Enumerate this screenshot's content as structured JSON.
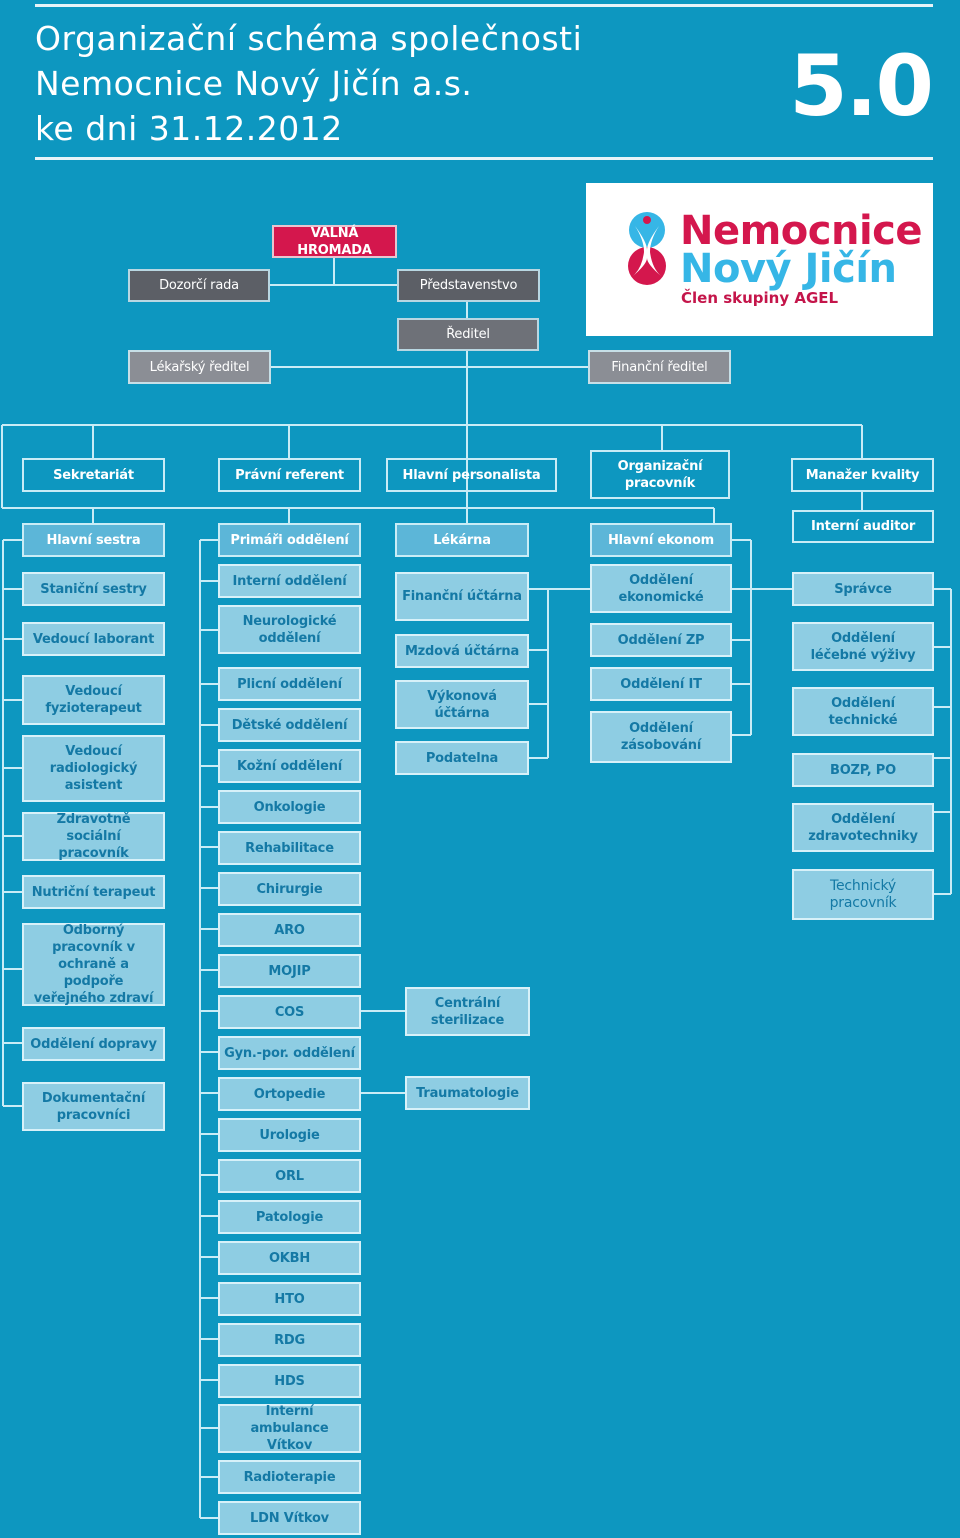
{
  "header": {
    "title_lines": [
      "Organizační schéma společnosti",
      "Nemocnice Nový Jičín a.s.",
      "ke dni 31.12.2012"
    ],
    "version": "5.0"
  },
  "logo": {
    "line1": "Nemocnice",
    "line2": "Nový Jičín",
    "line3": "Člen skupiny AGEL",
    "icon": "hospital-person-icon",
    "colors": {
      "red": "#d4174d",
      "blue": "#36b6e6"
    }
  },
  "colors": {
    "background": "#0d97c0",
    "general_meeting": "#d4174d",
    "board": "#5c5f66",
    "director": "#6e7178",
    "deputy_director": "#8b8e95",
    "section_head": "#5cb6d8",
    "department": "#8ecde3",
    "department_text": "#1479a5",
    "line": "#c9ecf6"
  },
  "governance": {
    "general_meeting": "VALNÁ HROMADA",
    "supervisory_board": "Dozorčí rada",
    "board_of_directors": "Představenstvo",
    "director": "Ředitel",
    "medical_director": "Lékařský ředitel",
    "financial_director": "Finanční ředitel"
  },
  "staff": {
    "secretariat": "Sekretariát",
    "legal": "Právní referent",
    "hr": "Hlavní personalista",
    "organizational": "Organizační pracovník",
    "quality": "Manažer kvality",
    "auditor": "Interní auditor"
  },
  "columns": {
    "nursing": {
      "head": "Hlavní sestra",
      "items": [
        "Staniční sestry",
        "Vedoucí laborant",
        "Vedoucí fyzioterapeut",
        "Vedoucí radiologický asistent",
        "Zdravotně sociální pracovník",
        "Nutriční terapeut",
        "Odborný pracovník v ochraně a podpoře veřejného zdraví",
        "Oddělení dopravy",
        "Dokumentační pracovníci"
      ]
    },
    "primary": {
      "head": "Primáři oddělení",
      "items": [
        "Interní oddělení",
        "Neurologické oddělení",
        "Plicní oddělení",
        "Dětské oddělení",
        "Kožní oddělení",
        "Onkologie",
        "Rehabilitace",
        "Chirurgie",
        "ARO",
        "MOJIP",
        "COS",
        "Gyn.-por. oddělení",
        "Ortopedie",
        "Urologie",
        "ORL",
        "Patologie",
        "OKBH",
        "HTO",
        "RDG",
        "HDS",
        "Interní ambulance Vítkov",
        "Radioterapie",
        "LDN Vítkov"
      ],
      "sub": {
        "cos": "Centrální sterilizace",
        "ortopedie": "Traumatologie"
      }
    },
    "pharmacy": {
      "head": "Lékárna",
      "items": [
        "Finanční účtárna",
        "Mzdová účtárna",
        "Výkonová účtárna",
        "Podatelna"
      ]
    },
    "economy": {
      "head": "Hlavní ekonom",
      "items": [
        "Oddělení ekonomické",
        "Oddělení ZP",
        "Oddělení IT",
        "Oddělení zásobování"
      ]
    },
    "technical": {
      "items": [
        "Správce",
        "Oddělení léčebné výživy",
        "Oddělení technické",
        "BOZP, PO",
        "Oddělení zdravotechniky",
        "Technický pracovník"
      ]
    }
  }
}
